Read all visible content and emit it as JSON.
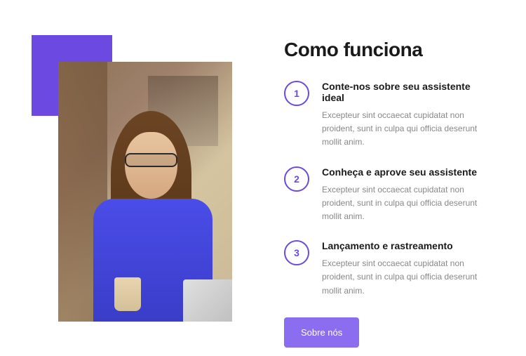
{
  "heading": "Como funciona",
  "steps": [
    {
      "number": "1",
      "title": "Conte-nos sobre seu assistente ideal",
      "description": "Excepteur sint occaecat cupidatat non proident, sunt in culpa qui officia deserunt mollit anim."
    },
    {
      "number": "2",
      "title": "Conheça e aprove seu assistente",
      "description": "Excepteur sint occaecat cupidatat non proident, sunt in culpa qui officia deserunt mollit anim."
    },
    {
      "number": "3",
      "title": "Lançamento e rastreamento",
      "description": "Excepteur sint occaecat cupidatat non proident, sunt in culpa qui officia deserunt mollit anim."
    }
  ],
  "cta": {
    "label": "Sobre nós"
  },
  "colors": {
    "accent": "#6c4ae2",
    "button": "#8b6ef0"
  }
}
